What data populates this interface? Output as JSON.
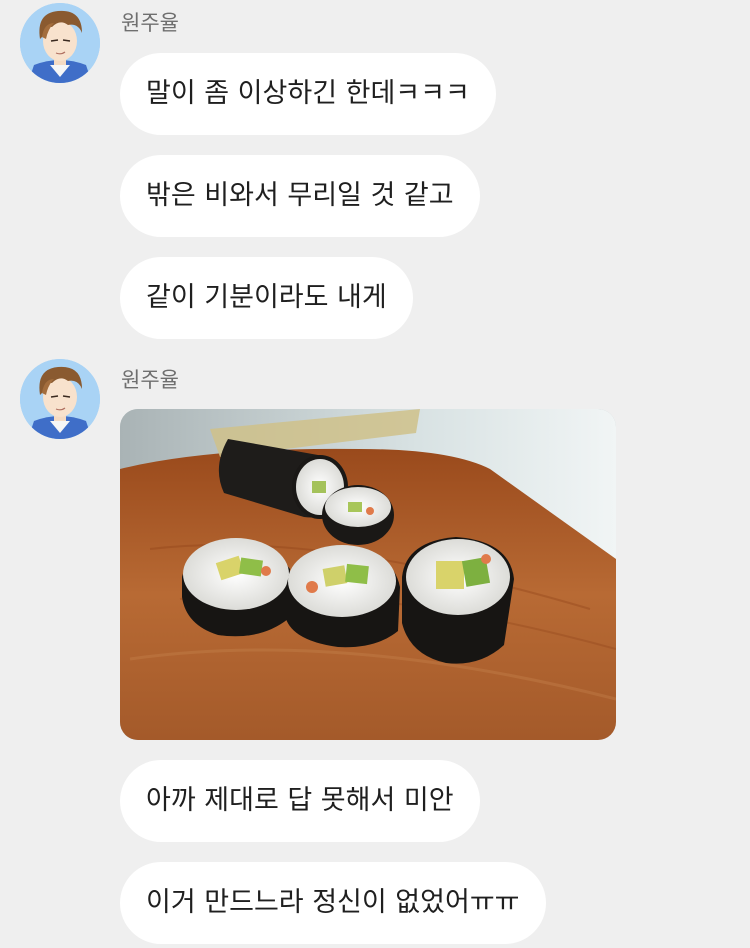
{
  "chat": {
    "groups": [
      {
        "sender": "원주율",
        "messages": [
          "말이 좀 이상하긴 한데ㅋㅋㅋ",
          "밖은 비와서 무리일 것 같고",
          "같이 기분이라도 내게"
        ]
      },
      {
        "sender": "원주율",
        "photo": {
          "subject": "kimbap-photo"
        },
        "messages": [
          "아까 제대로 답 못해서 미안",
          "이거 만드느라 정신이 없었어ㅠㅠ"
        ]
      }
    ]
  },
  "colors": {
    "background": "#efefef",
    "bubble": "#ffffff",
    "sender_name": "#6f6f6f",
    "text": "#1f1f1f"
  }
}
